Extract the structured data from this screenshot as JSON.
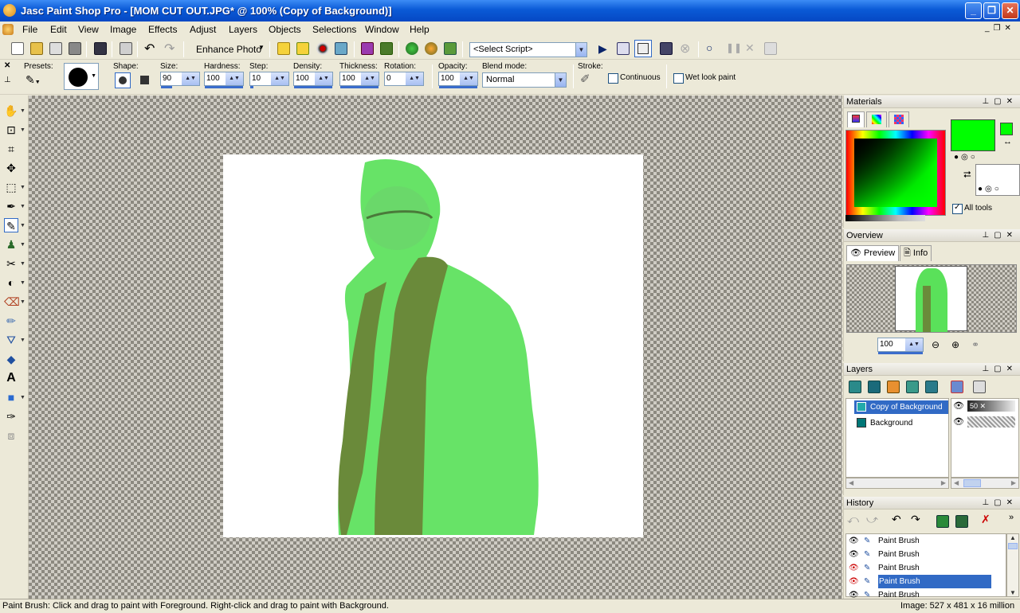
{
  "window": {
    "title": "Jasc Paint Shop Pro - [MOM CUT OUT.JPG* @ 100% (Copy of Background)]",
    "minimize": "_",
    "maximize": "❐",
    "close": "✕"
  },
  "menu": [
    "File",
    "Edit",
    "View",
    "Image",
    "Effects",
    "Adjust",
    "Layers",
    "Objects",
    "Selections",
    "Window",
    "Help"
  ],
  "toolbar": {
    "enhance_photo": "Enhance Photo",
    "select_script": "<Select Script>"
  },
  "tool_options": {
    "presets_label": "Presets:",
    "shape_label": "Shape:",
    "size_label": "Size:",
    "size_value": "90",
    "hardness_label": "Hardness:",
    "hardness_value": "100",
    "step_label": "Step:",
    "step_value": "10",
    "density_label": "Density:",
    "density_value": "100",
    "thickness_label": "Thickness:",
    "thickness_value": "100",
    "rotation_label": "Rotation:",
    "rotation_value": "0",
    "opacity_label": "Opacity:",
    "opacity_value": "100",
    "blend_label": "Blend mode:",
    "blend_value": "Normal",
    "stroke_label": "Stroke:",
    "continuous_label": "Continuous",
    "wet_look_label": "Wet look paint"
  },
  "materials": {
    "title": "Materials",
    "all_tools": "All tools",
    "foreground_color": "#00ff00",
    "background_color": "#ffffff"
  },
  "overview": {
    "title": "Overview",
    "tab_preview": "Preview",
    "tab_info": "Info",
    "zoom_value": "100"
  },
  "layers": {
    "title": "Layers",
    "items": [
      {
        "name": "Copy of Background",
        "opacity": "50"
      },
      {
        "name": "Background",
        "opacity": ""
      }
    ]
  },
  "history": {
    "title": "History",
    "items": [
      "Paint Brush",
      "Paint Brush",
      "Paint Brush",
      "Paint Brush",
      "Paint Brush"
    ]
  },
  "status": {
    "hint": "Paint Brush: Click and drag to paint with Foreground. Right-click and drag to paint with Background.",
    "image_info": "Image:  527 x 481 x 16 million"
  }
}
